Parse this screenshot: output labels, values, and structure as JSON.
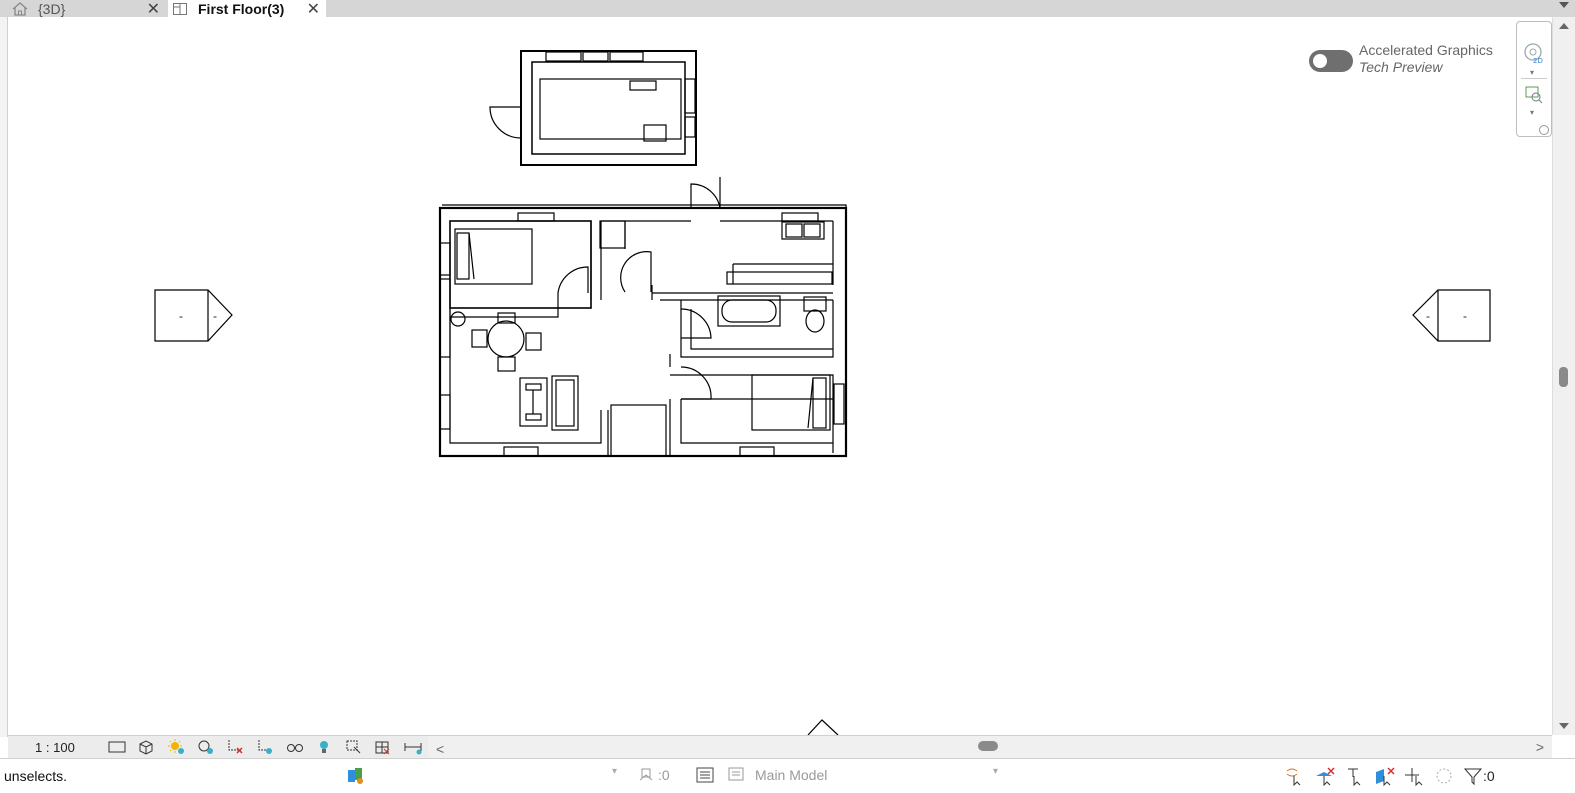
{
  "tabs": [
    {
      "label": "{3D}",
      "icon": "home-icon",
      "active": false
    },
    {
      "label": "First Floor(3)",
      "icon": "floor-plan-icon",
      "active": true
    }
  ],
  "accelerated": {
    "title": "Accelerated Graphics",
    "subtitle": "Tech Preview",
    "enabled": false
  },
  "elevation_markers": {
    "left": [
      "-",
      "-"
    ],
    "right": [
      "-",
      "-"
    ]
  },
  "view_control": {
    "scale": "1 : 100"
  },
  "status": {
    "message": "unselects.",
    "worksets_count": ":0",
    "model": "Main Model",
    "filter_count": ":0"
  },
  "colors": {
    "accent_blue": "#2f8fdc",
    "warn_red": "#d83030",
    "bulb_cyan": "#3ab0c8"
  }
}
